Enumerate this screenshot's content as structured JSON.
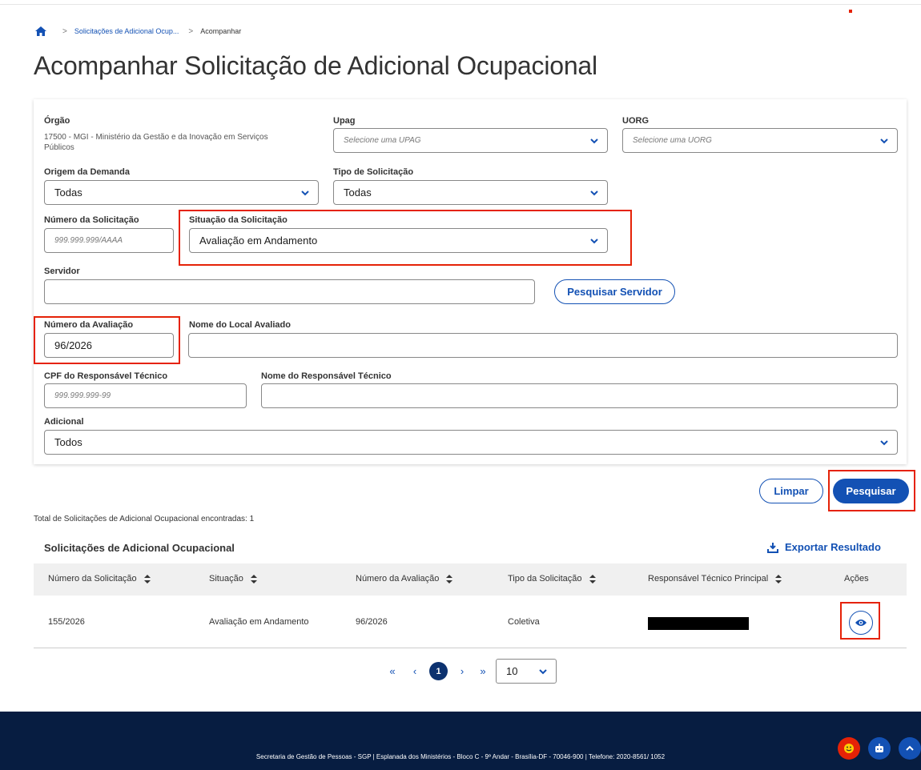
{
  "breadcrumb": {
    "items": [
      "Solicitações de Adicional Ocup...",
      "Acompanhar"
    ]
  },
  "page_title": "Acompanhar Solicitação de Adicional Ocupacional",
  "form": {
    "orgao": {
      "label": "Órgão",
      "value": "17500 - MGI - Ministério da Gestão e da Inovação em Serviços Públicos"
    },
    "upag": {
      "label": "Upag",
      "placeholder": "Selecione uma UPAG"
    },
    "uorg": {
      "label": "UORG",
      "placeholder": "Selecione uma UORG"
    },
    "origem": {
      "label": "Origem da Demanda",
      "value": "Todas"
    },
    "tipo": {
      "label": "Tipo de Solicitação",
      "value": "Todas"
    },
    "numero_solicitacao": {
      "label": "Número da Solicitação",
      "placeholder": "999.999.999/AAAA"
    },
    "situacao": {
      "label": "Situação da Solicitação",
      "value": "Avaliação em Andamento"
    },
    "servidor": {
      "label": "Servidor",
      "value": ""
    },
    "pesquisar_servidor": "Pesquisar Servidor",
    "numero_avaliacao": {
      "label": "Número da Avaliação",
      "value": "96/2026"
    },
    "nome_local": {
      "label": "Nome do Local Avaliado",
      "value": ""
    },
    "cpf": {
      "label": "CPF do Responsável Técnico",
      "placeholder": "999.999.999-99"
    },
    "nome_resp": {
      "label": "Nome do Responsável Técnico",
      "value": ""
    },
    "adicional": {
      "label": "Adicional",
      "value": "Todos"
    }
  },
  "actions": {
    "limpar": "Limpar",
    "pesquisar": "Pesquisar"
  },
  "results": {
    "total_text": "Total de Solicitações de Adicional Ocupacional encontradas: 1",
    "section_title": "Solicitações de Adicional Ocupacional",
    "export_label": "Exportar Resultado",
    "columns": [
      "Número da Solicitação",
      "Situação",
      "Número da Avaliação",
      "Tipo da Solicitação",
      "Responsável Técnico Principal",
      "Ações"
    ],
    "rows": [
      {
        "numero": "155/2026",
        "situacao": "Avaliação em Andamento",
        "avaliacao": "96/2026",
        "tipo": "Coletiva"
      }
    ]
  },
  "pagination": {
    "current_page": "1",
    "page_size": "10"
  },
  "footer": {
    "text": "Secretaria de Gestão de Pessoas - SGP | Esplanada dos Ministérios - Bloco C - 9º Andar - Brasília-DF - 70046-900 | Telefone: 2020-8561/ 1052"
  },
  "colors": {
    "primary": "#1351b4",
    "dark_blue": "#0c326f",
    "footer_bg": "#071d41",
    "highlight": "#e52207"
  }
}
